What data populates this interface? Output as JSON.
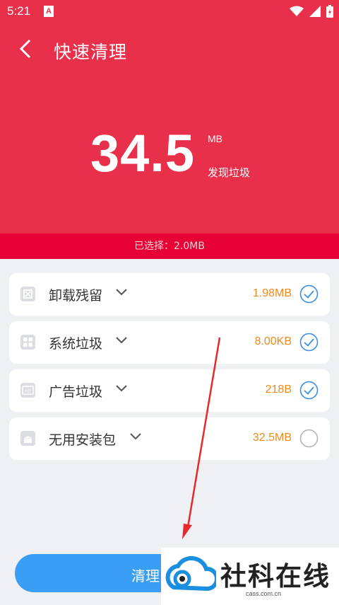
{
  "status_bar": {
    "time": "5:21",
    "app_icon_letter": "A"
  },
  "header": {
    "title": "快速清理",
    "amount": "34.5",
    "unit": "MB",
    "found_label": "发现垃圾"
  },
  "selection": {
    "text": "已选择：2.0MB"
  },
  "items": [
    {
      "label": "卸载残留",
      "size": "1.98MB",
      "checked": true,
      "icon": "uninstall-residue-icon"
    },
    {
      "label": "系统垃圾",
      "size": "8.00KB",
      "checked": true,
      "icon": "system-junk-icon"
    },
    {
      "label": "广告垃圾",
      "size": "218B",
      "checked": true,
      "icon": "ad-junk-icon"
    },
    {
      "label": "无用安装包",
      "size": "32.5MB",
      "checked": false,
      "icon": "apk-package-icon"
    }
  ],
  "clean_button": {
    "label": "清理"
  },
  "watermark": {
    "text": "社科在线",
    "url": "cass.com.cn"
  },
  "colors": {
    "primary_red": "#e8304a",
    "selection_bar": "#e60036",
    "size_orange": "#f18a1b",
    "check_blue": "#3a8ee6",
    "button_blue": "#3a9df6"
  }
}
